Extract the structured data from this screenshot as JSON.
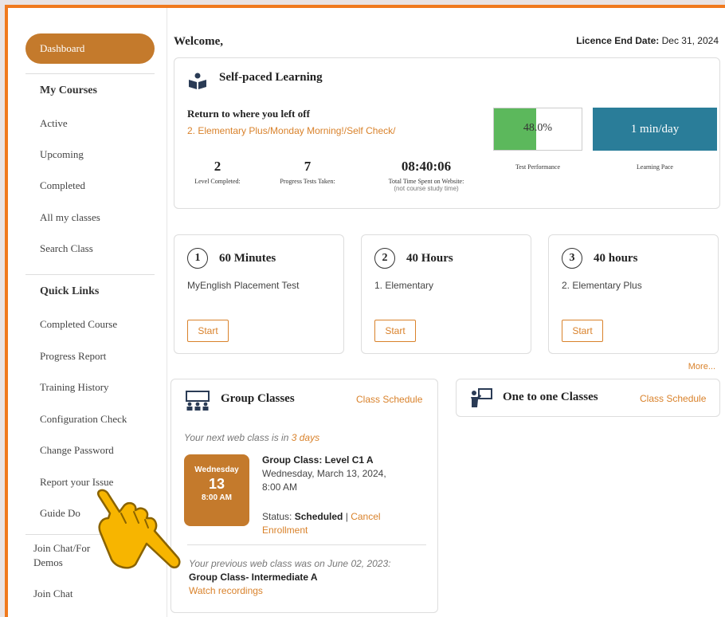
{
  "sidebar": {
    "dashboard": "Dashboard",
    "my_courses": "My Courses",
    "courses": [
      "Active",
      "Upcoming",
      "Completed",
      "All my classes",
      "Search Class"
    ],
    "quick_links": "Quick Links",
    "links": [
      "Completed Course",
      "Progress Report",
      "Training History",
      "Configuration Check",
      "Change Password",
      "Report your Issue",
      "Guide Do"
    ],
    "join_chat_forum": "Join Chat/For",
    "demos": "Demos",
    "join_chat": "Join Chat"
  },
  "header": {
    "welcome": "Welcome,",
    "licence_label": "Licence End Date:",
    "licence_date": "Dec 31, 2024"
  },
  "self_paced": {
    "title": "Self-paced Learning",
    "return_label": "Return to where you left off",
    "return_path": "2. Elementary Plus/Monday Morning!/Self Check/",
    "stats": [
      {
        "value": "2",
        "label": "Level Completed:"
      },
      {
        "value": "7",
        "label": "Progress Tests Taken:"
      },
      {
        "value": "08:40:06",
        "label": "Total Time Spent on Website:",
        "sub": "(not course study time)"
      }
    ],
    "test_performance": {
      "percent": 48.0,
      "value_text": "48.0%",
      "label": "Test Performance",
      "color": "#5cb85c"
    },
    "learning_pace": {
      "value": "1 min/day",
      "label": "Learning Pace",
      "color": "#2a7d99"
    }
  },
  "courses": [
    {
      "num": "1",
      "duration": "60 Minutes",
      "name": "MyEnglish Placement Test",
      "button": "Start"
    },
    {
      "num": "2",
      "duration": "40 Hours",
      "name": "1. Elementary",
      "button": "Start"
    },
    {
      "num": "3",
      "duration": "40 hours",
      "name": "2. Elementary Plus",
      "button": "Start"
    }
  ],
  "more": "More...",
  "group_classes": {
    "title": "Group Classes",
    "schedule_link": "Class Schedule",
    "next_prefix": "Your next web class is in",
    "next_days": "3 days",
    "date": {
      "weekday": "Wednesday",
      "day": "13",
      "time": "8:00 AM"
    },
    "class_title": "Group Class: Level C1 A",
    "class_date": "Wednesday, March 13, 2024,",
    "class_time": "8:00 AM",
    "status_label": "Status:",
    "status_value": "Scheduled",
    "separator": "|",
    "cancel": "Cancel",
    "enrollment": "Enrollment",
    "prev_text": "Your previous web class was on June 02, 2023:",
    "prev_class": "Group Class- Intermediate A",
    "watch": "Watch recordings"
  },
  "one_to_one": {
    "title": "One to one Classes",
    "schedule_link": "Class Schedule"
  },
  "colors": {
    "accent": "#d9822b",
    "frame": "#f07a1e",
    "hand": "#f7b500"
  }
}
